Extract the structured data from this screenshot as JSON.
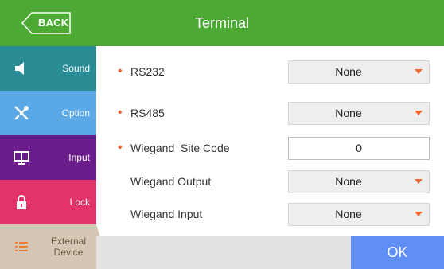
{
  "header": {
    "back_label": "BACK",
    "title": "Terminal",
    "color": "#4caa34"
  },
  "sidebar": {
    "items": [
      {
        "label": "Sound",
        "icon": "speaker-icon",
        "color": "#2a8c95"
      },
      {
        "label": "Option",
        "icon": "tools-icon",
        "color": "#5aa8e6"
      },
      {
        "label": "Input",
        "icon": "monitor-icon",
        "color": "#6a1c8a"
      },
      {
        "label": "Lock",
        "icon": "lock-icon",
        "color": "#e4336a"
      },
      {
        "label": "External Device",
        "icon": "list-icon",
        "color": "#d6c7b4",
        "selected": true
      }
    ]
  },
  "settings": {
    "rs232": {
      "label": "RS232",
      "value": "None",
      "required": true
    },
    "rs485": {
      "label": "RS485",
      "value": "None",
      "required": true
    },
    "wiegand_site_code": {
      "label": "Wiegand  Site Code",
      "value": "0",
      "required": true
    },
    "wiegand_output": {
      "label": "Wiegand Output",
      "value": "None",
      "required": false
    },
    "wiegand_input": {
      "label": "Wiegand Input",
      "value": "None",
      "required": false
    }
  },
  "footer": {
    "ok_label": "OK",
    "ok_color": "#5f8ef4"
  }
}
